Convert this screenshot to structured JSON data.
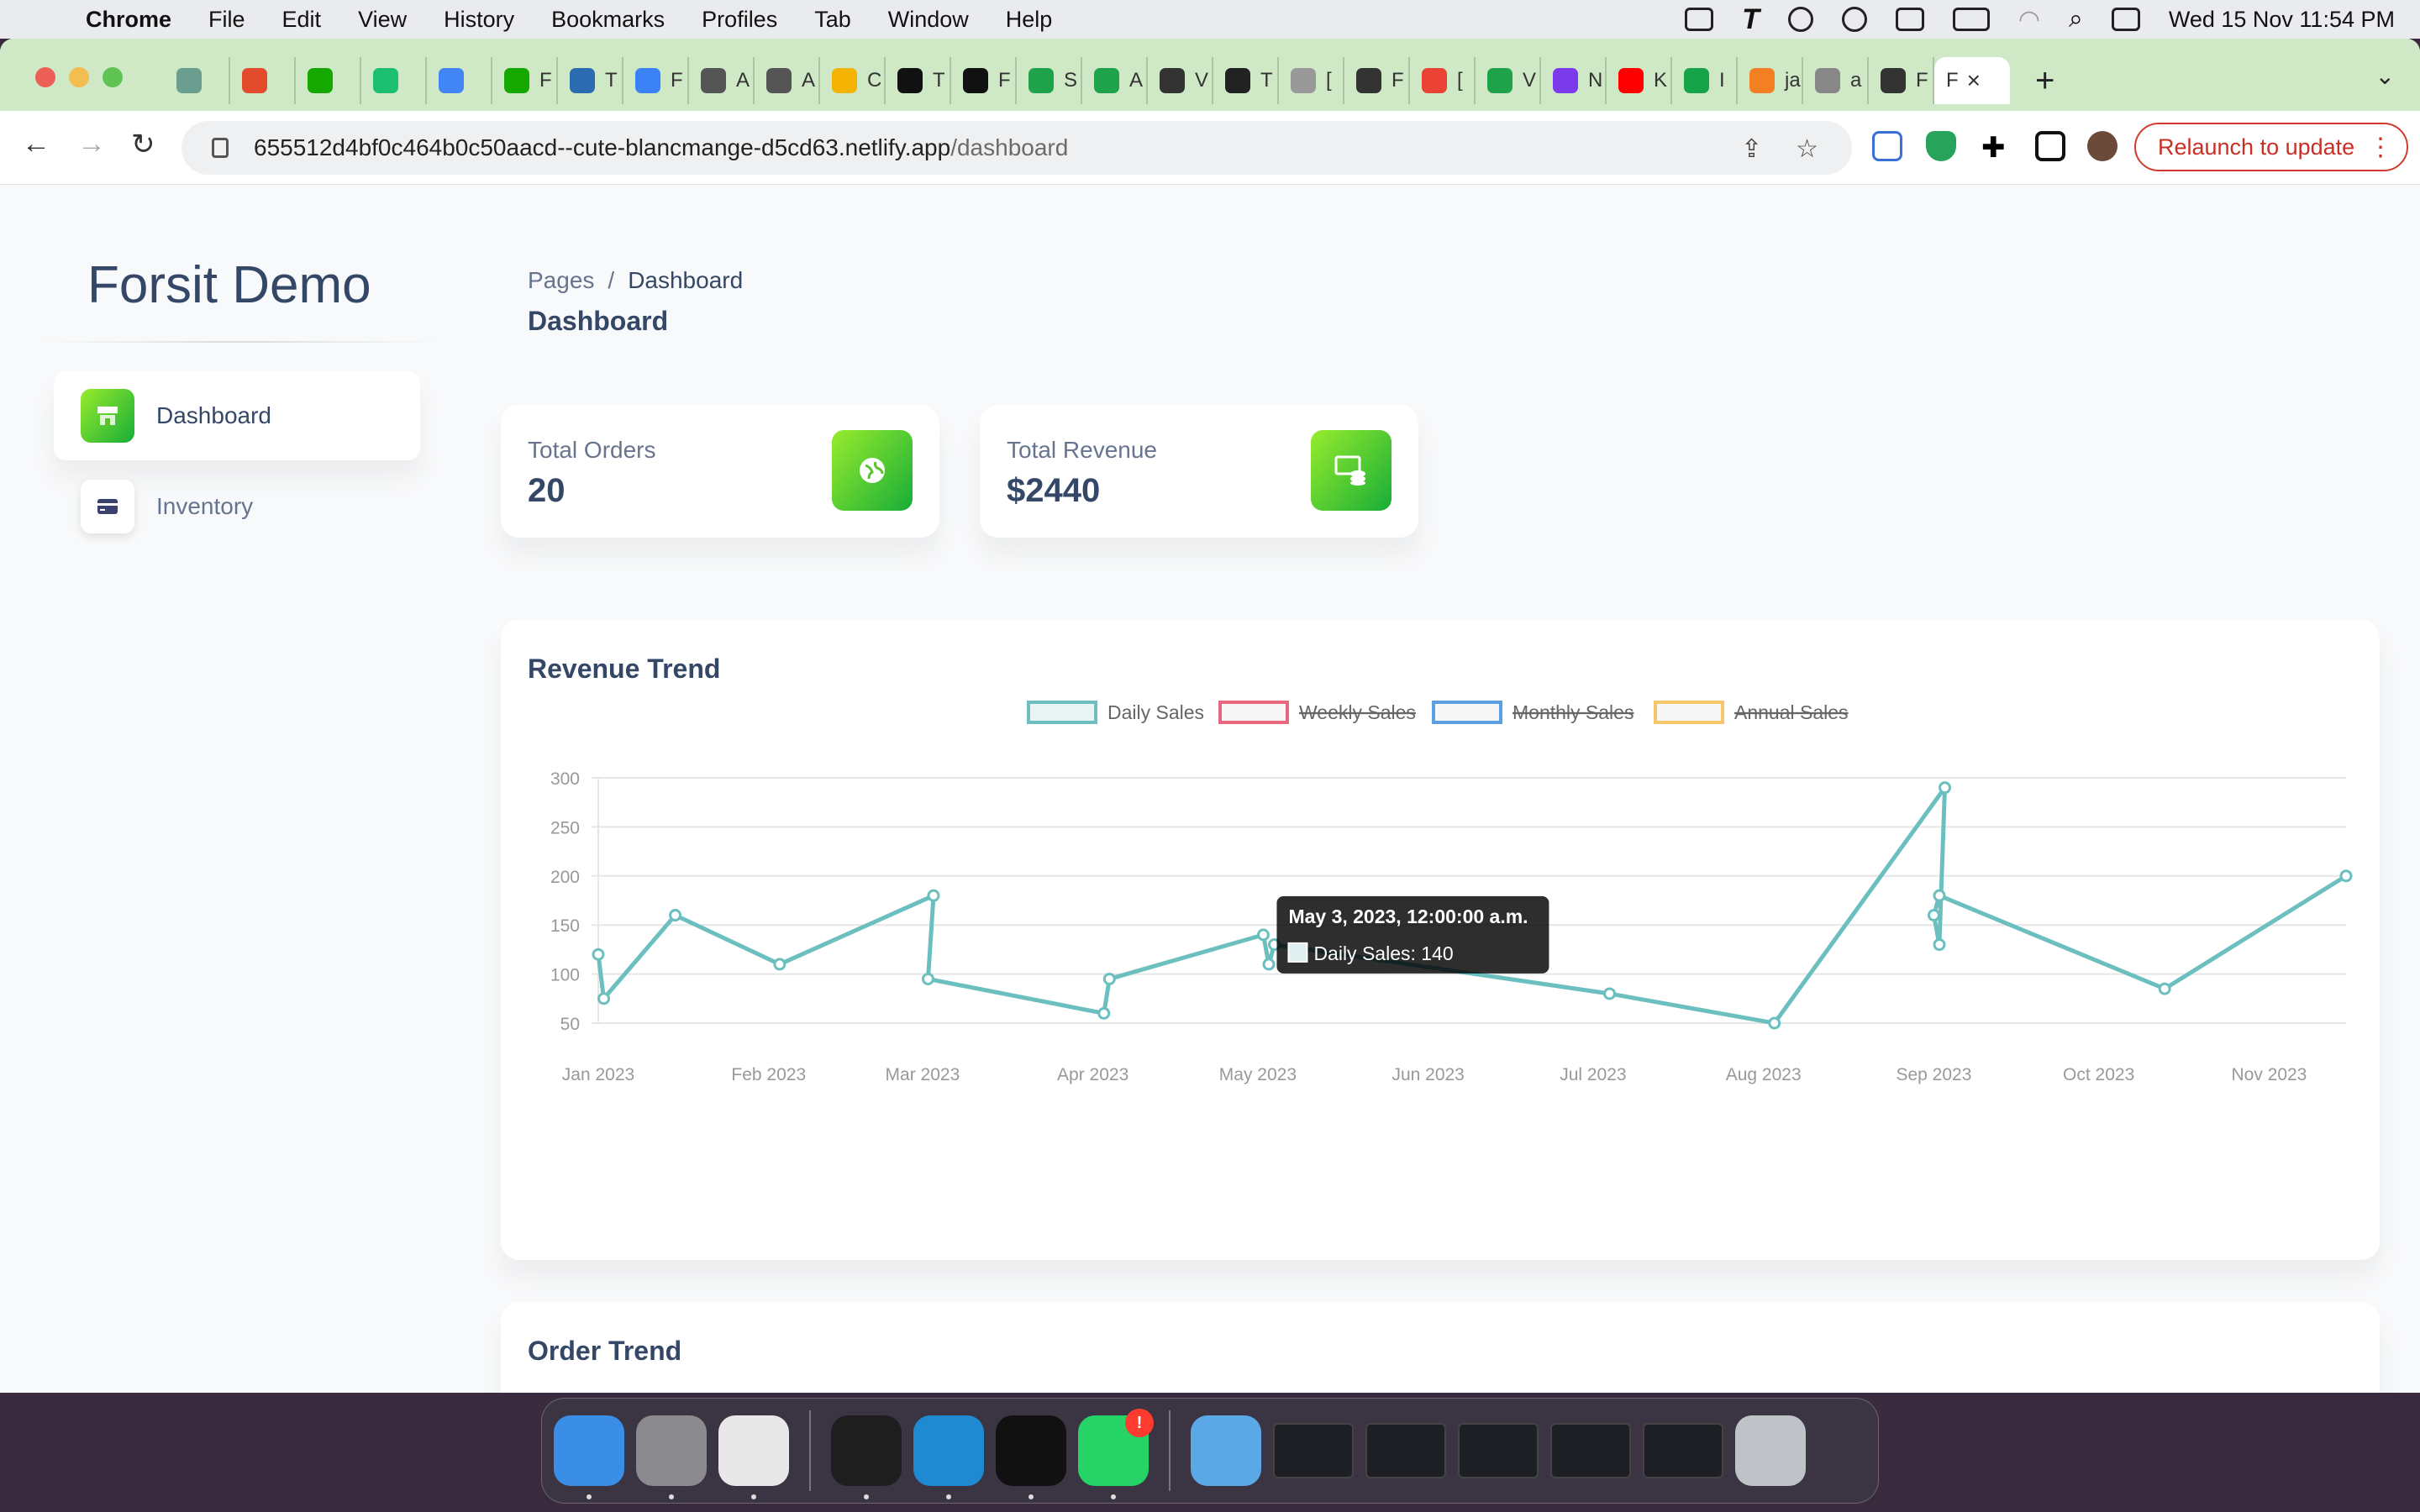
{
  "menubar": {
    "app_name": "Chrome",
    "items": [
      "File",
      "Edit",
      "View",
      "History",
      "Bookmarks",
      "Profiles",
      "Tab",
      "Window",
      "Help"
    ],
    "clock": "Wed 15 Nov  11:54 PM"
  },
  "browser": {
    "tabs": [
      {
        "icon": "openai-icon",
        "label": "",
        "color": "#6b9e8f"
      },
      {
        "icon": "alert-icon",
        "label": "",
        "color": "#e24b2c"
      },
      {
        "icon": "upwork-icon",
        "label": "",
        "color": "#14a800"
      },
      {
        "icon": "fiverr-icon",
        "label": "",
        "color": "#1dbf73"
      },
      {
        "icon": "google-icon",
        "label": "",
        "color": "#4285f4"
      },
      {
        "icon": "upwork-icon",
        "label": "F",
        "color": "#14a800"
      },
      {
        "icon": "tool-icon",
        "label": "T",
        "color": "#2b6cb0"
      },
      {
        "icon": "flag-icon",
        "label": "F",
        "color": "#3b82f6"
      },
      {
        "icon": "apple-icon",
        "label": "A",
        "color": "#555555"
      },
      {
        "icon": "apple-icon",
        "label": "A",
        "color": "#555555"
      },
      {
        "icon": "bulb-icon",
        "label": "C",
        "color": "#f5b301"
      },
      {
        "icon": "t-icon",
        "label": "T",
        "color": "#111111"
      },
      {
        "icon": "n-icon",
        "label": "F",
        "color": "#111111"
      },
      {
        "icon": "house-icon",
        "label": "S",
        "color": "#1fa34a"
      },
      {
        "icon": "house-icon",
        "label": "A",
        "color": "#1fa34a"
      },
      {
        "icon": "grid-icon",
        "label": "V",
        "color": "#333333"
      },
      {
        "icon": "bowtie-icon",
        "label": "T",
        "color": "#222222"
      },
      {
        "icon": "globe-icon",
        "label": "[",
        "color": "#999999"
      },
      {
        "icon": "grid-icon",
        "label": "F",
        "color": "#333333"
      },
      {
        "icon": "gmail-icon",
        "label": "[",
        "color": "#ea4335"
      },
      {
        "icon": "play-icon",
        "label": "V",
        "color": "#1fa34a"
      },
      {
        "icon": "b-icon",
        "label": "N",
        "color": "#7c3aed"
      },
      {
        "icon": "youtube-icon",
        "label": "K",
        "color": "#ff0000"
      },
      {
        "icon": "r-icon",
        "label": "I",
        "color": "#16a34a"
      },
      {
        "icon": "stack-icon",
        "label": "ja",
        "color": "#f48024"
      },
      {
        "icon": "github-icon",
        "label": "a",
        "color": "#888888"
      },
      {
        "icon": "grid-icon",
        "label": "F",
        "color": "#333333"
      }
    ],
    "active_tab_label": "F",
    "url_host": "655512d4bf0c464b0c50aacd--cute-blancmange-d5cd63.netlify.app",
    "url_path": "/dashboard",
    "relaunch_label": "Relaunch to update"
  },
  "sidebar": {
    "brand": "Forsit Demo",
    "items": [
      {
        "label": "Dashboard",
        "icon": "shop-icon",
        "active": true
      },
      {
        "label": "Inventory",
        "icon": "card-icon",
        "active": false
      }
    ]
  },
  "header": {
    "breadcrumb_root": "Pages",
    "breadcrumb_sep": "/",
    "breadcrumb_current": "Dashboard",
    "title": "Dashboard"
  },
  "stats": [
    {
      "label": "Total Orders",
      "value": "20",
      "icon": "globe-icon"
    },
    {
      "label": "Total Revenue",
      "value": "$2440",
      "icon": "coins-icon"
    }
  ],
  "revenue_card": {
    "title": "Revenue Trend",
    "tooltip": {
      "title": "May 3, 2023, 12:00:00 a.m.",
      "body": "Daily Sales: 140"
    }
  },
  "order_card": {
    "title": "Order Trend"
  },
  "colors": {
    "accent_green": "#82d616",
    "daily": "#6cbfbf",
    "weekly": "#e7687e",
    "monthly": "#5aa0e0",
    "annual": "#f5c76a",
    "text_dark": "#344767",
    "text_muted": "#67748e"
  },
  "chart_data": {
    "type": "line",
    "title": "",
    "xlabel": "",
    "ylabel": "",
    "ylim": [
      50,
      300
    ],
    "yticks": [
      300,
      250,
      200,
      150,
      100,
      50
    ],
    "xtick_labels": [
      "Jan 2023",
      "Feb 2023",
      "Mar 2023",
      "Apr 2023",
      "May 2023",
      "Jun 2023",
      "Jul 2023",
      "Aug 2023",
      "Sep 2023",
      "Oct 2023",
      "Nov 2023"
    ],
    "legend": [
      {
        "name": "Daily Sales",
        "hidden": false
      },
      {
        "name": "Weekly Sales",
        "hidden": true
      },
      {
        "name": "Monthly Sales",
        "hidden": true
      },
      {
        "name": "Annual Sales",
        "hidden": true
      }
    ],
    "legend_position": "top",
    "grid": true,
    "series": [
      {
        "name": "Daily Sales",
        "points": [
          {
            "x": "2023-01-01",
            "y": 120
          },
          {
            "x": "2023-01-02",
            "y": 75
          },
          {
            "x": "2023-01-15",
            "y": 160
          },
          {
            "x": "2023-02-03",
            "y": 110
          },
          {
            "x": "2023-03-03",
            "y": 180
          },
          {
            "x": "2023-03-02",
            "y": 95
          },
          {
            "x": "2023-04-03",
            "y": 60
          },
          {
            "x": "2023-04-04",
            "y": 95
          },
          {
            "x": "2023-05-02",
            "y": 140
          },
          {
            "x": "2023-05-03",
            "y": 110
          },
          {
            "x": "2023-05-04",
            "y": 130
          },
          {
            "x": "2023-07-04",
            "y": 80
          },
          {
            "x": "2023-08-03",
            "y": 50
          },
          {
            "x": "2023-09-03",
            "y": 290
          },
          {
            "x": "2023-09-02",
            "y": 130
          },
          {
            "x": "2023-09-01",
            "y": 160
          },
          {
            "x": "2023-09-02",
            "y": 180
          },
          {
            "x": "2023-10-13",
            "y": 85
          },
          {
            "x": "2023-11-15",
            "y": 200
          }
        ]
      }
    ]
  },
  "dock": {
    "apps": [
      {
        "icon": "finder-icon",
        "color": "#3a8ee6",
        "running": true
      },
      {
        "icon": "settings-icon",
        "color": "#8a8a8f",
        "running": true
      },
      {
        "icon": "chrome-icon",
        "color": "#e8e8e8",
        "running": true
      },
      {
        "icon": "terminal-icon",
        "color": "#1e1e1e",
        "running": true
      },
      {
        "icon": "vscode-icon",
        "color": "#1f8ad2",
        "running": true
      },
      {
        "icon": "iterm-icon",
        "color": "#111111",
        "running": true
      },
      {
        "icon": "whatsapp-icon",
        "color": "#25d366",
        "running": true,
        "badge": "!"
      }
    ]
  }
}
